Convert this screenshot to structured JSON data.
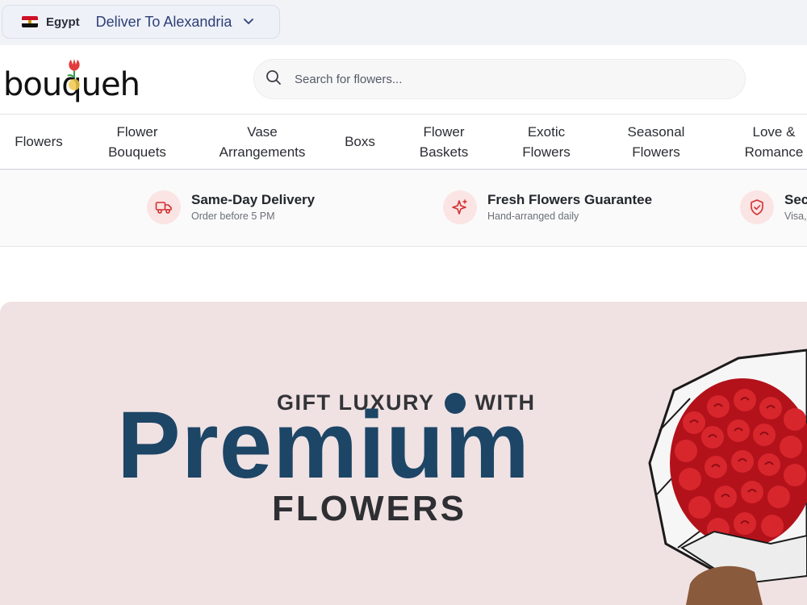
{
  "location": {
    "country": "Egypt",
    "deliver_label": "Deliver To Alexandria"
  },
  "header": {
    "logo_text": "bouqueh",
    "search_placeholder": "Search for flowers..."
  },
  "nav": {
    "items": [
      {
        "label": "Flowers"
      },
      {
        "label": "Flower\nBouquets"
      },
      {
        "label": "Vase\nArrangements"
      },
      {
        "label": "Boxs"
      },
      {
        "label": "Flower\nBaskets"
      },
      {
        "label": "Exotic\nFlowers"
      },
      {
        "label": "Seasonal\nFlowers"
      },
      {
        "label": "Love &\nRomance"
      }
    ]
  },
  "features": [
    {
      "icon": "truck-icon",
      "title": "Same-Day Delivery",
      "subtitle": "Order before 5 PM"
    },
    {
      "icon": "sparkle-icon",
      "title": "Fresh Flowers Guarantee",
      "subtitle": "Hand-arranged daily"
    },
    {
      "icon": "shield-check-icon",
      "title": "Sec",
      "subtitle": "Visa,"
    }
  ],
  "hero": {
    "line1_left": "GIFT LUXURY",
    "line1_right": "WITH",
    "line2": "Premium",
    "line3": "FLOWERS"
  },
  "colors": {
    "accent_red": "#d32f2f",
    "navy": "#1d4566",
    "hero_bg": "#f0e2e3"
  }
}
